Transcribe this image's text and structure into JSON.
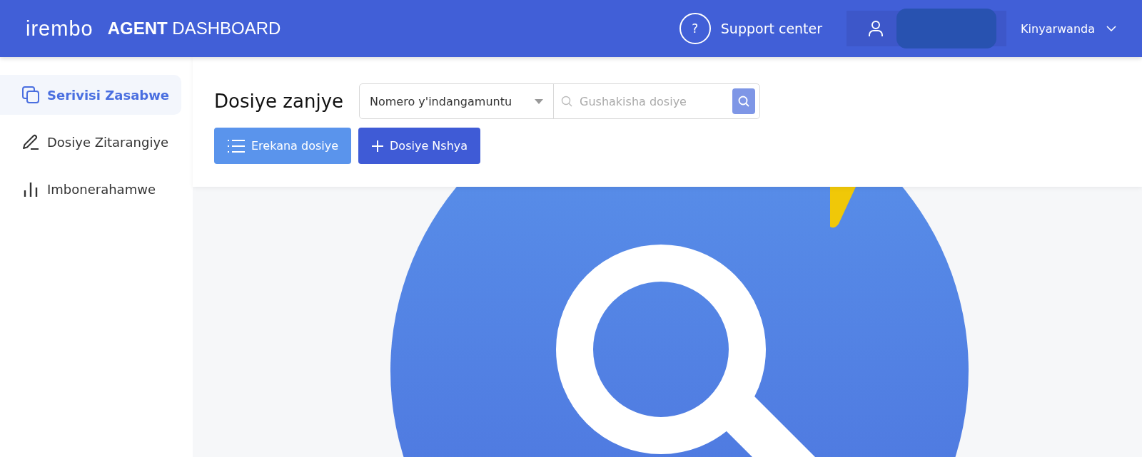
{
  "header": {
    "logo": "irembo",
    "title": "**AGENT** DASHBOARD",
    "support": {
      "icon_text": "?",
      "label": "Support center"
    },
    "language": "Kinyarwanda"
  },
  "sidebar": {
    "items": [
      {
        "label": "Serivisi Zasabwe",
        "selected": true
      },
      {
        "label": "Dosiye Zitarangiye",
        "selected": false
      },
      {
        "label": "Imbonerahamwe",
        "selected": false
      }
    ]
  },
  "main": {
    "title": "Dosiye zanjye",
    "search": {
      "filter": "Nomero y'indangamuntu",
      "placeholder": "Gushakisha dosiye"
    },
    "buttons": [
      {
        "label": "Erekana dosiye",
        "kind": "secondary"
      },
      {
        "label": "Dosiye Nshya",
        "kind": "primary"
      }
    ]
  }
}
